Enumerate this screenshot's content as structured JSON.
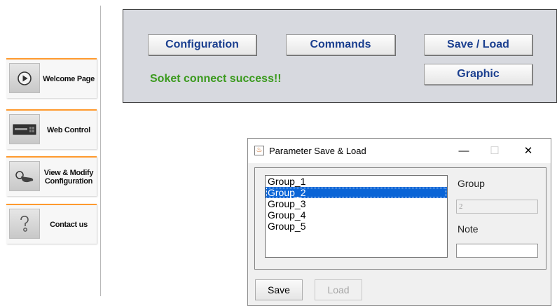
{
  "nav": {
    "items": [
      {
        "label": "Welcome Page",
        "icon": "play-icon"
      },
      {
        "label": "Web Control",
        "icon": "control-panel-icon"
      },
      {
        "label_line1": "View & Modify",
        "label_line2": "Configuration",
        "icon": "hand-pointer-icon"
      },
      {
        "label": "Contact us",
        "icon": "question-icon"
      }
    ],
    "accent_color": "#ff9a2e"
  },
  "panel": {
    "buttons": {
      "configuration": "Configuration",
      "commands": "Commands",
      "save_load": "Save / Load",
      "graphic": "Graphic"
    },
    "status": "Soket connect success!!",
    "status_color": "#3b9a1e",
    "button_text_color": "#1b3f8f"
  },
  "dialog": {
    "title": "Parameter Save & Load",
    "controls": {
      "minimize": "—",
      "maximize": "☐",
      "close": "✕"
    },
    "groups": [
      "Group_1",
      "Group_2",
      "Group_3",
      "Group_4",
      "Group_5"
    ],
    "selected_index": 1,
    "group_label": "Group",
    "group_value": "2",
    "note_label": "Note",
    "note_value": "",
    "save_label": "Save",
    "load_label": "Load"
  }
}
